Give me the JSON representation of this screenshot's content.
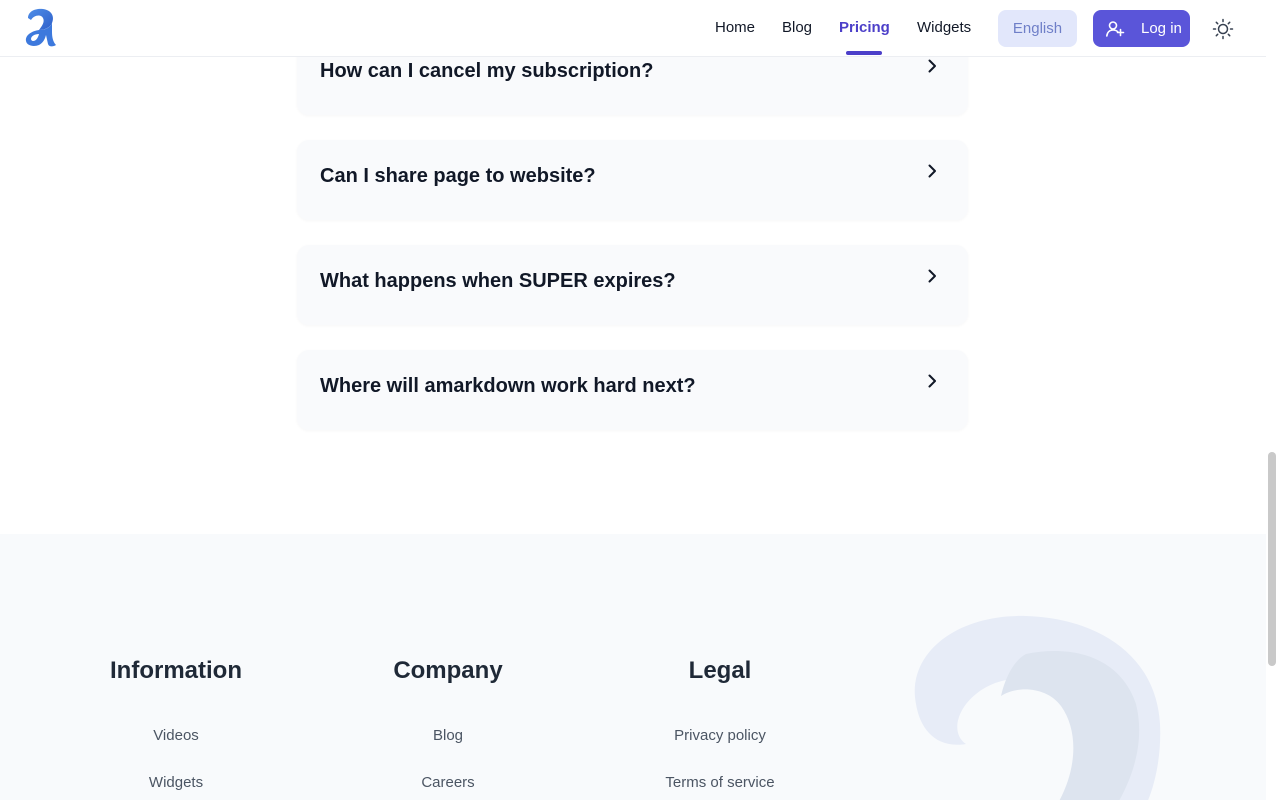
{
  "header": {
    "logo_icon": "amarkdown-logo-icon",
    "nav": [
      {
        "label": "Home",
        "active": false
      },
      {
        "label": "Blog",
        "active": false
      },
      {
        "label": "Pricing",
        "active": true
      },
      {
        "label": "Widgets",
        "active": false
      }
    ],
    "language_label": "English",
    "login_label": "Log in",
    "login_icon": "user-plus-icon",
    "theme_icon": "sun-icon"
  },
  "faq": {
    "items": [
      {
        "question": "How can I cancel my subscription?"
      },
      {
        "question": "Can I share page to website?"
      },
      {
        "question": "What happens when SUPER expires?"
      },
      {
        "question": "Where will amarkdown work hard next?"
      }
    ],
    "expand_icon": "chevron-right-icon"
  },
  "footer": {
    "columns": [
      {
        "heading": "Information",
        "links": [
          "Videos",
          "Widgets"
        ]
      },
      {
        "heading": "Company",
        "links": [
          "Blog",
          "Careers"
        ]
      },
      {
        "heading": "Legal",
        "links": [
          "Privacy policy",
          "Terms of service"
        ]
      }
    ],
    "decoration_icon": "amarkdown-watermark-icon"
  },
  "colors": {
    "accent": "#5a55d9",
    "active_nav": "#4c3fc9",
    "language_bg": "#e2e7fb",
    "footer_bg": "#f8fafc",
    "card_bg": "#f9fafc"
  }
}
